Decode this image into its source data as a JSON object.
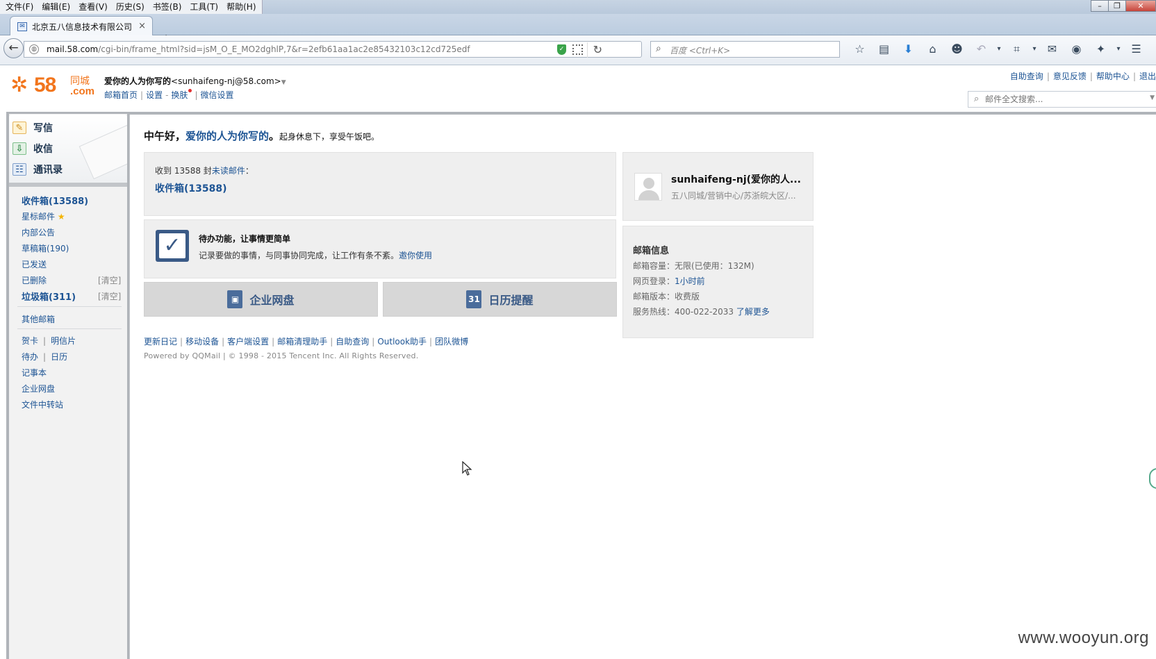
{
  "browser": {
    "menu": [
      "文件(F)",
      "编辑(E)",
      "查看(V)",
      "历史(S)",
      "书签(B)",
      "工具(T)",
      "帮助(H)"
    ],
    "tab_title": "北京五八信息技术有限公司",
    "tab_close": "×",
    "new_tab": "+",
    "url_host": "mail.58.com",
    "url_path": "/cgi-bin/frame_html?sid=jsM_O_E_MO2dghlP,7&r=2efb61aa1ac2e85432103c12cd725edf",
    "search_placeholder": "百度 <Ctrl+K>"
  },
  "header": {
    "logo_num": "58",
    "logo_tc": "同城",
    "logo_com": ".com",
    "account_name": "爱你的人为你写的",
    "account_email": "<sunhaifeng-nj@58.com>",
    "links": [
      "邮箱首页",
      "设置",
      "换肤",
      "微信设置"
    ],
    "top_links": [
      "自助查询",
      "意见反馈",
      "帮助中心",
      "退出"
    ],
    "search_placeholder": "邮件全文搜索..."
  },
  "sidebar": {
    "quick": [
      {
        "label": "写信",
        "icon": "compose-icon"
      },
      {
        "label": "收信",
        "icon": "inbox-download-icon"
      },
      {
        "label": "通讯录",
        "icon": "contacts-icon"
      }
    ],
    "folders": [
      {
        "label": "收件箱(13588)"
      },
      {
        "label": "星标邮件"
      },
      {
        "label": "内部公告"
      },
      {
        "label": "草稿箱(190)"
      },
      {
        "label": "已发送"
      },
      {
        "label": "已删除"
      },
      {
        "label": "垃圾箱(311)"
      }
    ],
    "clear_label": "[清空]",
    "other": "其他邮箱",
    "apps": {
      "card": "贺卡",
      "postcard": "明信片",
      "todo": "待办",
      "calendar": "日历",
      "notes": "记事本",
      "disk": "企业网盘",
      "transfer": "文件中转站"
    }
  },
  "main": {
    "greeting": "中午好，",
    "name": "爱你的人为你写的",
    "period": "。",
    "greeting_tip": "起身休息下，享受午饭吧。",
    "unread_prefix": "收到 13588 封",
    "unread_link": "未读邮件",
    "unread_suffix": "：",
    "inbox_link": "收件箱(13588)",
    "todo_title": "待办功能，让事情更简单",
    "todo_desc": "记录要做的事情，与同事协同完成，让工作有条不紊。",
    "todo_invite": "邀你使用",
    "btn_disk": "企业网盘",
    "btn_calendar": "日历提醒",
    "calendar_day": "31",
    "footer_links": [
      "更新日记",
      "移动设备",
      "客户端设置",
      "邮箱清理助手",
      "自助查询",
      "Outlook助手",
      "团队微博"
    ],
    "copyright": "Powered by QQMail  | © 1998 - 2015 Tencent Inc. All Rights Reserved."
  },
  "profile": {
    "name": "sunhaifeng-nj(爱你的人...",
    "dept": "五八同城/营销中心/苏浙皖大区/..."
  },
  "mailbox_info": {
    "title": "邮箱信息",
    "capacity": "邮箱容量：无限(已使用：132M)",
    "login_label": "网页登录：",
    "login_value": "1小时前",
    "version": "邮箱版本：收费版",
    "hotline": "服务热线：400-022-2033",
    "more": "了解更多"
  },
  "watermark": "www.wooyun.org",
  "colors": {
    "link": "#1d5494",
    "brand": "#f2751c",
    "panel": "#efefef"
  }
}
